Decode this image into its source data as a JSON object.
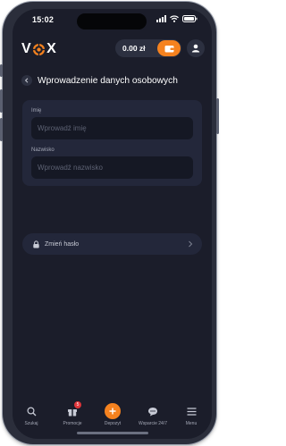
{
  "status_bar": {
    "time": "15:02"
  },
  "header": {
    "logo_text_left": "V",
    "logo_text_right": "X",
    "balance": "0.00 zł"
  },
  "page": {
    "title": "Wprowadzenie danych osobowych"
  },
  "form": {
    "first_name": {
      "label": "Imię",
      "placeholder": "Wprowadź imię",
      "value": ""
    },
    "last_name": {
      "label": "Nazwisko",
      "placeholder": "Wprowadź nazwisko",
      "value": ""
    }
  },
  "password": {
    "label": "Zmień hasło"
  },
  "bottom_nav": {
    "items": [
      {
        "label": "Szukaj",
        "icon": "search-icon"
      },
      {
        "label": "Promocje",
        "icon": "gift-icon",
        "badge": "5"
      },
      {
        "label": "Depozyt",
        "icon": "plus-icon"
      },
      {
        "label": "Wsparcie 24/7",
        "icon": "chat-icon"
      },
      {
        "label": "Menu",
        "icon": "menu-icon"
      }
    ]
  },
  "colors": {
    "accent": "#f5821f",
    "background": "#1b1d2a",
    "card": "#23273a",
    "badge": "#e0353a"
  }
}
